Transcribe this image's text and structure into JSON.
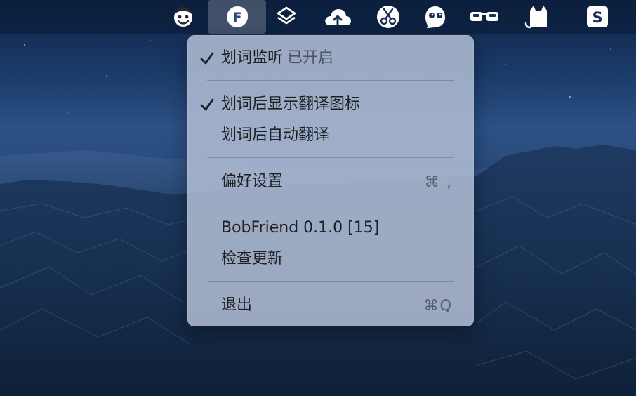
{
  "menubar": {
    "items": [
      {
        "name": "face-mascot-icon"
      },
      {
        "name": "bob-translate-icon",
        "letter": "F"
      },
      {
        "name": "shortcuts-layers-icon"
      },
      {
        "name": "cloud-upload-icon"
      },
      {
        "name": "scissors-icon"
      },
      {
        "name": "ghost-icon"
      },
      {
        "name": "glasses-icon"
      },
      {
        "name": "cat-icon"
      },
      {
        "name": "s-app-icon",
        "letter": "S"
      }
    ]
  },
  "menu": {
    "word_monitor": {
      "label": "划词监听",
      "status": "已开启",
      "checked": true
    },
    "show_icon": {
      "label": "划词后显示翻译图标",
      "checked": true
    },
    "auto_translate": {
      "label": "划词后自动翻译",
      "checked": false
    },
    "preferences": {
      "label": "偏好设置",
      "shortcut": "⌘ ,"
    },
    "version": {
      "label": "BobFriend 0.1.0 [15]"
    },
    "check_update": {
      "label": "检查更新"
    },
    "quit": {
      "label": "退出",
      "shortcut": "⌘Q"
    }
  },
  "colors": {
    "menu_bg": "#b2bed4",
    "menubar_bg": "#0a1a34",
    "text": "#1e1f23",
    "text_dim": "#4f5562"
  }
}
